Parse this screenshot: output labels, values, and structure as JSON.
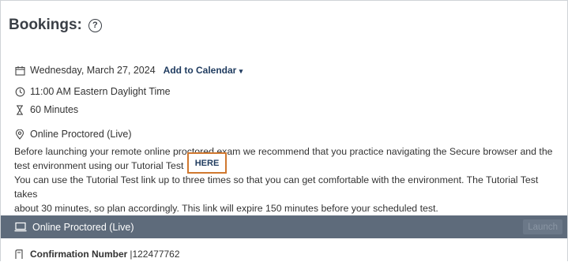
{
  "header": {
    "title": "Bookings:",
    "help_symbol": "?",
    "help_icon": "question-circle-icon"
  },
  "details": {
    "date": "Wednesday, March 27, 2024",
    "add_to_calendar_label": "Add to Calendar",
    "add_to_calendar_caret": "▾",
    "time": "11:00 AM Eastern Daylight Time",
    "duration": "60 Minutes",
    "mode": "Online Proctored (Live)",
    "icons": {
      "date": "calendar-icon",
      "time": "clock-icon",
      "duration": "hourglass-icon",
      "mode": "location-pin-icon"
    }
  },
  "description": {
    "line1": "Before launching your remote online proctored exam we recommend that you practice navigating the Secure browser and the",
    "line2": "test environment using our Tutorial Test",
    "line3": "You can use the Tutorial Test link up to three times so that you can get comfortable with the environment. The Tutorial Test takes",
    "line4": "about 30 minutes, so plan accordingly. This link will expire 150 minutes before your scheduled test.",
    "here_button_label": "HERE"
  },
  "launch_bar": {
    "label": "Online Proctored (Live)",
    "launch_label": "Launch",
    "icon": "laptop-icon"
  },
  "confirmation": {
    "label": "Confirmation Number",
    "value": "|122477762",
    "icon": "receipt-icon"
  },
  "colors": {
    "bar_background": "#5e6b7b",
    "link": "#1f3b5f",
    "here_border": "#d0782f",
    "text": "#333333"
  }
}
